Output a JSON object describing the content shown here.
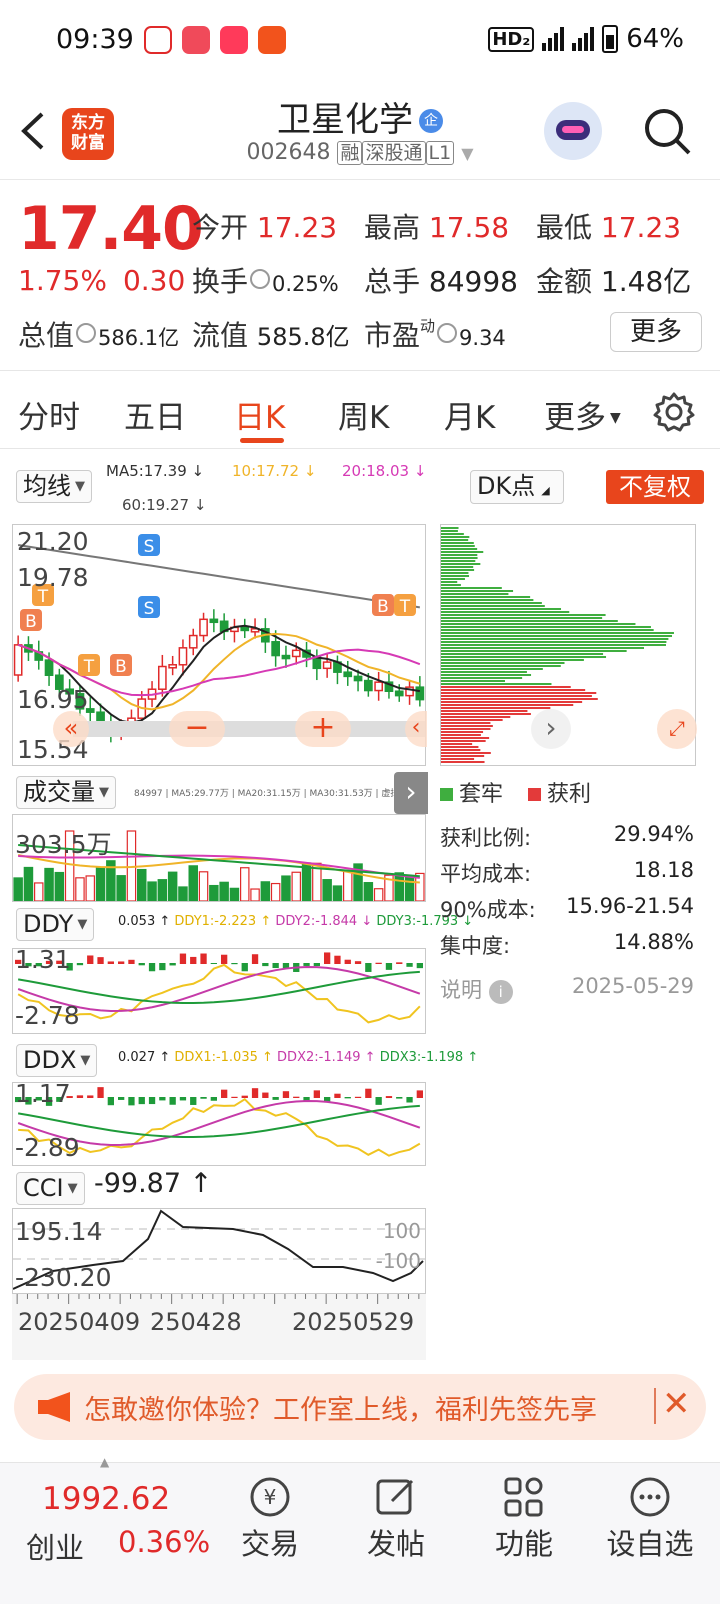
{
  "status_bar": {
    "time": "09:39",
    "network": "HD₂ 5G 4G",
    "battery": "64%"
  },
  "header": {
    "back_icon": "chevron-left-icon",
    "logo_text": [
      "东方",
      "财富"
    ],
    "stock_name": "卫星化学",
    "enterprise_badge": "企",
    "stock_code": "002648",
    "tags": [
      "融",
      "深股通",
      "L1"
    ]
  },
  "quote": {
    "price": "17.40",
    "change_pct": "1.75%",
    "change_amt": "0.30",
    "open_label": "今开",
    "open": "17.23",
    "high_label": "最高",
    "high": "17.58",
    "low_label": "最低",
    "low": "17.23",
    "turnover_label": "换手",
    "turnover": "0.25%",
    "volume_label": "总手",
    "volume": "84998",
    "amount_label": "金额",
    "amount": "1.48亿",
    "total_cap_label": "总值",
    "total_cap": "586.1亿",
    "float_cap_label": "流值",
    "float_cap": "585.8亿",
    "pe_label": "市盈",
    "pe_sup": "动",
    "pe": "9.34",
    "more_button": "更多"
  },
  "tabs": [
    "分时",
    "五日",
    "日K",
    "周K",
    "月K",
    "更多"
  ],
  "active_tab": "日K",
  "kline": {
    "ma_selector": "均线",
    "ma5": "MA5:17.39 ↓",
    "ma10": "10:17.72 ↓",
    "ma20": "20:18.03 ↓",
    "ma60": "60:19.27 ↓",
    "dk_button": "DK点",
    "adjust_button": "不复权",
    "y_max": "21.20",
    "y_2": "19.78",
    "y_3": "16.95",
    "y_min": "15.54",
    "colors": {
      "ma5": "#222222",
      "ma10": "#f0b429",
      "ma20": "#d63ab5",
      "ma60": "#777777",
      "up": "#e02a2a",
      "down": "#1e9b3a"
    }
  },
  "volume": {
    "selector": "成交量",
    "legend": "84997 | MA5:29.77万 | MA20:31.15万 | MA30:31.53万 | 虚拟成交量:31.84万",
    "y_max": "303.5万"
  },
  "ddy": {
    "selector": "DDY",
    "v0": "0.053 ↑",
    "v1": "DDY1:-2.223 ↑",
    "v2": "DDY2:-1.844 ↓",
    "v3": "DDY3:-1.793 ↓",
    "y_top": "1.31",
    "y_bottom": "-2.78"
  },
  "ddx": {
    "selector": "DDX",
    "v0": "0.027 ↑",
    "v1": "DDX1:-1.035 ↑",
    "v2": "DDX2:-1.149 ↑",
    "v3": "DDX3:-1.198 ↑",
    "y_top": "1.17",
    "y_bottom": "-2.89"
  },
  "cci": {
    "selector": "CCI",
    "value": "-99.87 ↑",
    "y_top": "195.14",
    "y_bottom": "-230.20",
    "ref_top": "100",
    "ref_bottom": "-100",
    "dates": [
      "20250409",
      "250428",
      "20250529"
    ]
  },
  "chips": {
    "legend_trapped": "套牢",
    "legend_profit": "获利",
    "profit_ratio_label": "获利比例:",
    "profit_ratio": "29.94%",
    "avg_cost_label": "平均成本:",
    "avg_cost": "18.18",
    "cost90_label": "90%成本:",
    "cost90": "15.96-21.54",
    "concentration_label": "集中度:",
    "concentration": "14.88%",
    "note_label": "说明",
    "date": "2025-05-29"
  },
  "banner": {
    "text": "怎敢邀你体验？工作室上线，福利先签先享",
    "close_icon": "close-icon"
  },
  "bottom_bar": {
    "index_value": "1992.62",
    "index_name": "创业",
    "index_change": "0.36%",
    "items": [
      "交易",
      "发帖",
      "功能",
      "设自选"
    ]
  }
}
